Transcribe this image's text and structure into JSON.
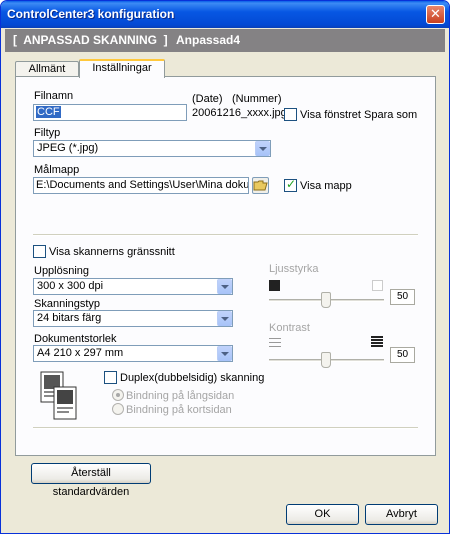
{
  "window": {
    "title": "ControlCenter3 konfiguration",
    "close_glyph": "✕"
  },
  "header": {
    "left": "[  ANPASSAD SKANNING  ]",
    "right": "Anpassad4"
  },
  "tabs": [
    {
      "label": "Allmänt",
      "active": false
    },
    {
      "label": "Inställningar",
      "active": true
    }
  ],
  "file": {
    "filename_label": "Filnamn",
    "filename_value": "CCF",
    "date_label": "(Date)",
    "number_label": "(Nummer)",
    "example": "20061216_xxxx.jpg",
    "show_save_as_label": "Visa fönstret Spara som",
    "show_save_as_checked": false,
    "filetype_label": "Filtyp",
    "filetype_value": "JPEG (*.jpg)",
    "folder_label": "Målmapp",
    "folder_value": "E:\\Documents and Settings\\User\\Mina dokument\\Min",
    "show_folder_label": "Visa mapp",
    "show_folder_checked": true
  },
  "scanner": {
    "show_interface_label": "Visa skannerns gränssnitt",
    "show_interface_checked": false,
    "resolution_label": "Upplösning",
    "resolution_value": "300 x 300 dpi",
    "scantype_label": "Skanningstyp",
    "scantype_value": "24 bitars färg",
    "docsize_label": "Dokumentstorlek",
    "docsize_value": "A4 210 x 297 mm",
    "brightness_label": "Ljusstyrka",
    "brightness_value": "50",
    "contrast_label": "Kontrast",
    "contrast_value": "50"
  },
  "duplex": {
    "label": "Duplex(dubbelsidig) skanning",
    "checked": false,
    "long_edge_label": "Bindning på långsidan",
    "short_edge_label": "Bindning på kortsidan"
  },
  "buttons": {
    "reset": "Återställ standardvärden",
    "ok": "OK",
    "cancel": "Avbryt"
  },
  "icons": [
    "close-icon",
    "folder-icon",
    "dropdown-arrow-icon",
    "duplex-document-icon",
    "dark-square-icon",
    "light-square-icon",
    "contrast-low-icon",
    "contrast-high-icon"
  ]
}
